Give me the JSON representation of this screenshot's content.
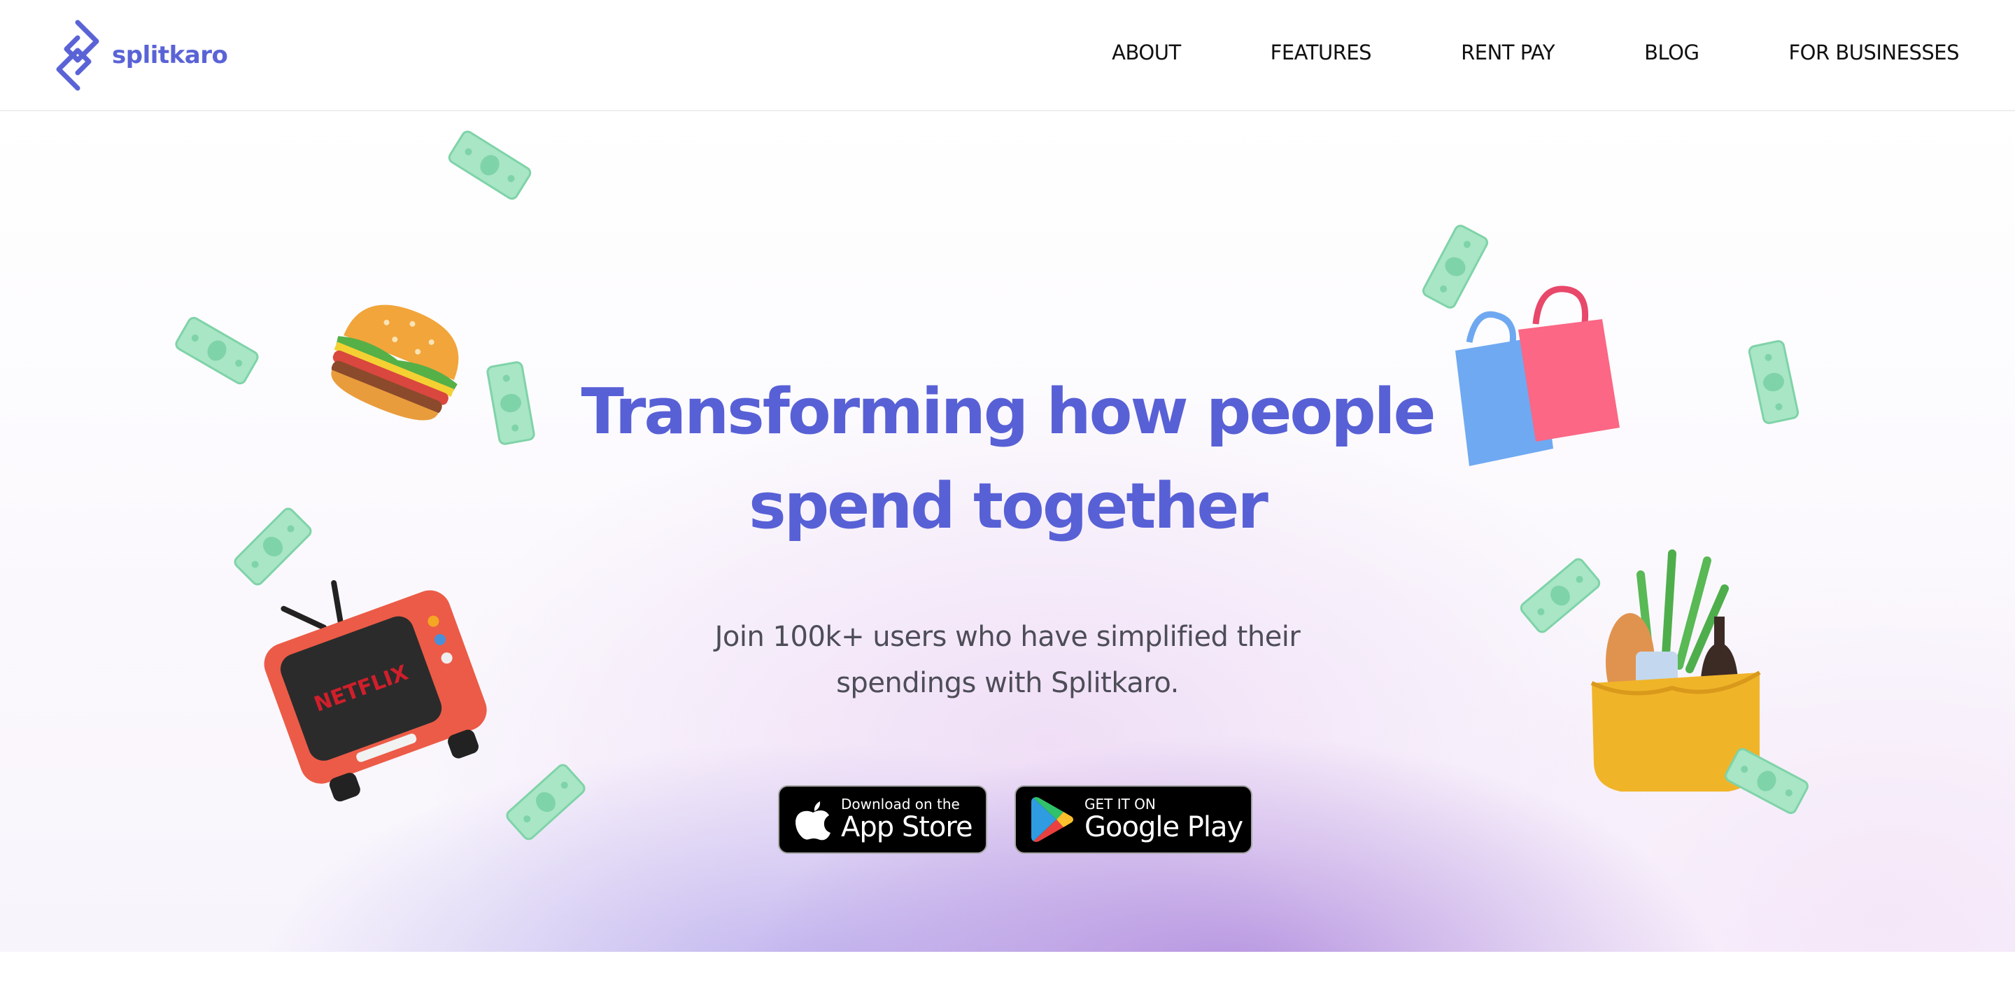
{
  "brand": {
    "name": "splitkaro",
    "color": "#5a63d6"
  },
  "nav": {
    "items": [
      {
        "label": "ABOUT"
      },
      {
        "label": "FEATURES"
      },
      {
        "label": "RENT PAY"
      },
      {
        "label": "BLOG"
      },
      {
        "label": "FOR BUSINESSES"
      }
    ]
  },
  "hero": {
    "headline_line1": "Transforming how people",
    "headline_line2": "spend together",
    "subtitle_line1": "Join 100k+ users who have simplified their",
    "subtitle_line2": "spendings with Splitkaro.",
    "headline_color": "#5860d6"
  },
  "store_buttons": {
    "app_store": {
      "small": "Download on the",
      "large": "App Store",
      "icon": "apple-icon"
    },
    "google_play": {
      "small": "GET IT ON",
      "large": "Google Play",
      "icon": "google-play-icon"
    }
  },
  "illustrations": {
    "tv_screen_text": "NETFLIX",
    "items": [
      "burger-icon",
      "retro-tv-icon",
      "shopping-bags-icon",
      "grocery-basket-icon",
      "money-bill-icon"
    ]
  }
}
